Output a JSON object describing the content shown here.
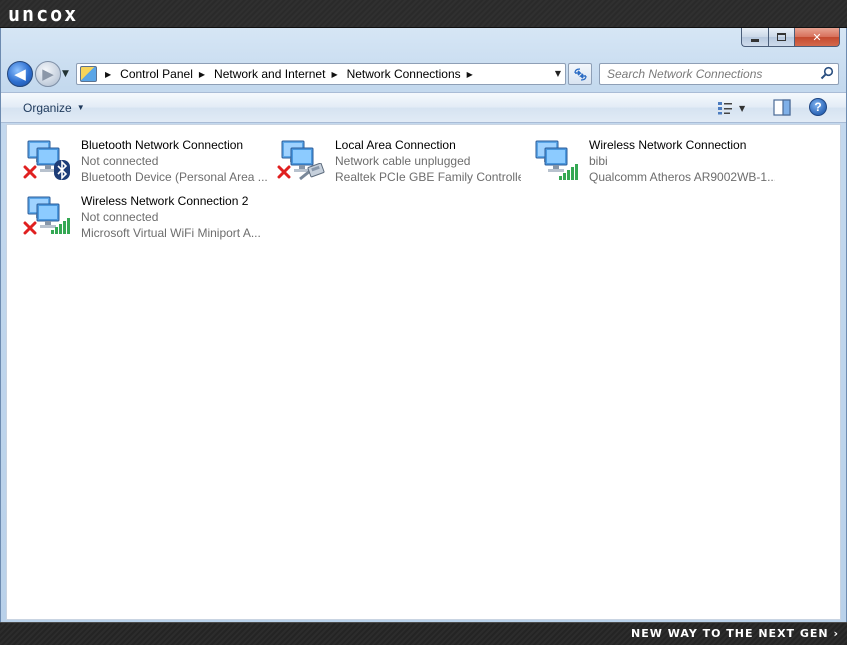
{
  "brand": {
    "logo_text": "uncox",
    "tagline": "NEW WAY TO THE NEXT GEN ›"
  },
  "window": {
    "caption_buttons": {
      "close_label": "✕"
    }
  },
  "navigation": {
    "back_label": "◀",
    "forward_label": "▶",
    "breadcrumbs": [
      "Control Panel",
      "Network and Internet",
      "Network Connections"
    ],
    "search_placeholder": "Search Network Connections"
  },
  "toolbar": {
    "organize_label": "Organize",
    "help_label": "?"
  },
  "connections": [
    {
      "name": "Bluetooth Network Connection",
      "status": "Not connected",
      "device": "Bluetooth Device (Personal Area ...",
      "badge": "bluetooth-icon",
      "error": true
    },
    {
      "name": "Local Area Connection",
      "status": "Network cable unplugged",
      "device": "Realtek PCIe GBE Family Controller",
      "badge": "ethernet-cable-icon",
      "error": true
    },
    {
      "name": "Wireless Network Connection",
      "status": "bibi",
      "device": "Qualcomm Atheros AR9002WB-1...",
      "badge": "wifi-signal-icon",
      "error": false
    },
    {
      "name": "Wireless Network Connection 2",
      "status": "Not connected",
      "device": "Microsoft Virtual WiFi Miniport A...",
      "badge": "wifi-signal-icon",
      "error": true
    }
  ],
  "colors": {
    "accent": "#2e6fd0",
    "error": "#e02020",
    "signal": "#34a853"
  }
}
